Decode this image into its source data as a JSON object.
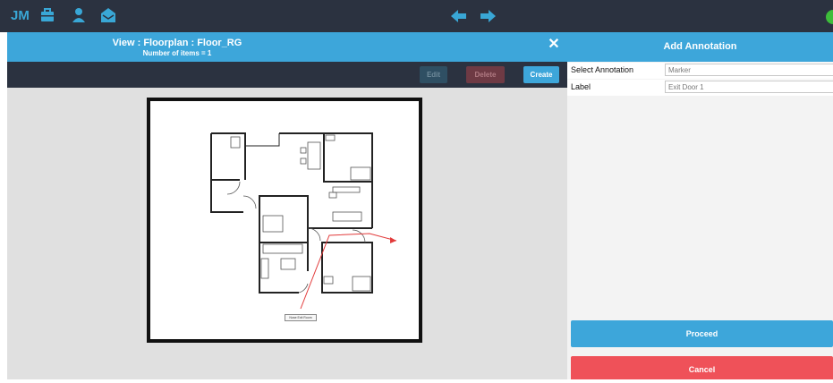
{
  "topbar": {
    "logo": "JM",
    "icons": [
      "briefcase-icon",
      "user-icon",
      "mail-icon"
    ],
    "nav": [
      "arrow-left-icon",
      "arrow-right-icon"
    ],
    "status_color": "#3dbd3a"
  },
  "view": {
    "title": "View : Floorplan : Floor_RG",
    "count": "Number of items = 1"
  },
  "toolbar": {
    "edit_label": "Edit",
    "delete_label": "Delete",
    "create_label": "Create"
  },
  "floorplan": {
    "marker_label": "Nose Exit Room"
  },
  "annotation": {
    "header": "Add Annotation",
    "select_label": "Select Annotation",
    "select_value": "Marker",
    "label_label": "Label",
    "label_value": "Exit Door 1",
    "proceed_label": "Proceed",
    "cancel_label": "Cancel"
  },
  "colors": {
    "accent": "#3da6da",
    "dark": "#2b3240",
    "danger": "#ef5159"
  }
}
